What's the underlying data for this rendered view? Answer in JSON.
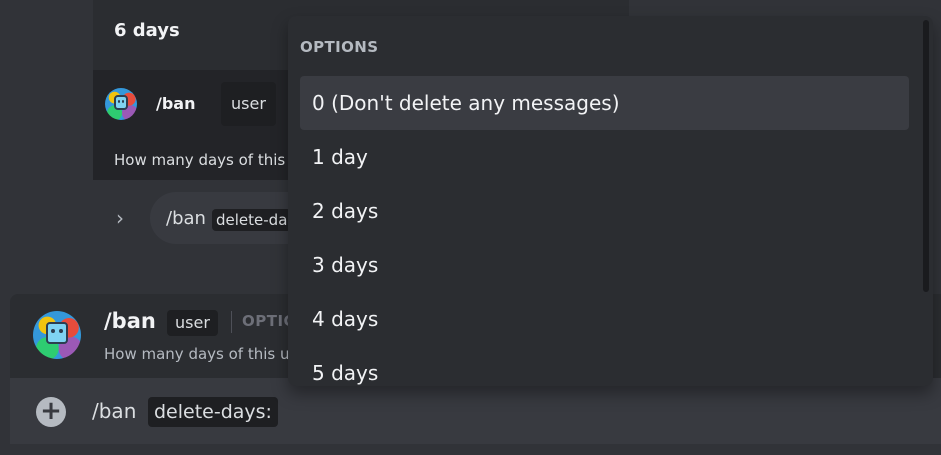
{
  "background_card": {
    "days_label": "6 days",
    "row": {
      "command": "/ban",
      "param": "user",
      "description": "How many days of this"
    },
    "pill": {
      "command": "/ban",
      "param": "delete-da"
    }
  },
  "composer_preview": {
    "command": "/ban",
    "param": "user",
    "options_label": "OPTIC",
    "description": "How many days of this u"
  },
  "composer": {
    "command": "/ban",
    "param": "delete-days:",
    "plus_icon": "plus-circle-icon"
  },
  "dropdown": {
    "header": "OPTIONS",
    "options": [
      {
        "label": "0 (Don't delete any messages)",
        "selected": true
      },
      {
        "label": "1 day",
        "selected": false
      },
      {
        "label": "2 days",
        "selected": false
      },
      {
        "label": "3 days",
        "selected": false
      },
      {
        "label": "4 days",
        "selected": false
      },
      {
        "label": "5 days",
        "selected": false
      }
    ]
  },
  "colors": {
    "background": "#313338",
    "panel": "#2b2d31",
    "input": "#383a40",
    "chip": "#1e1f22",
    "selected": "#3a3c42"
  }
}
